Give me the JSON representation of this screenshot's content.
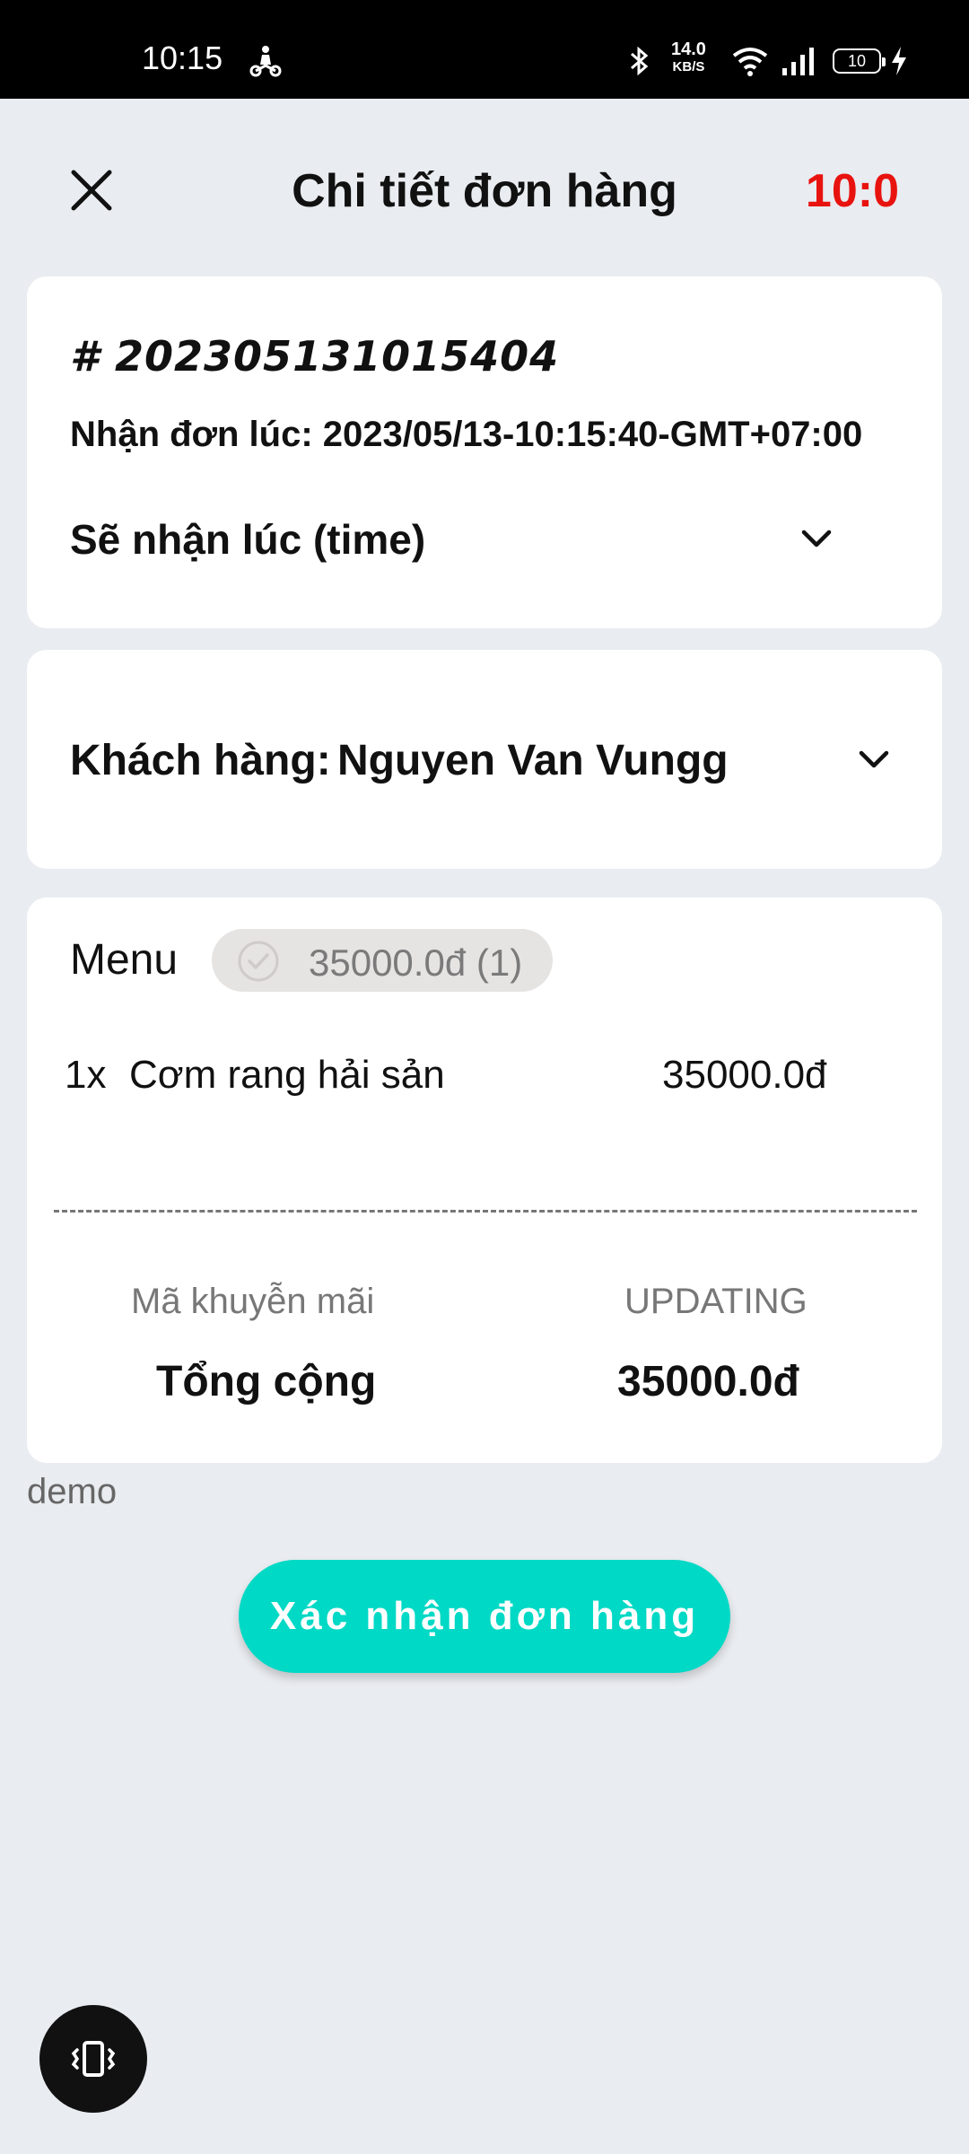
{
  "status_bar": {
    "time": "10:15",
    "speed_value": "14.0",
    "speed_unit": "KB/S",
    "battery": "10",
    "icons": [
      "rider-icon",
      "bluetooth-icon",
      "wifi-icon",
      "signal-icon",
      "battery-icon",
      "charging-icon"
    ]
  },
  "header": {
    "title": "Chi tiết đơn hàng",
    "timer": "10:0",
    "timer_color": "#e8130f",
    "close_icon": "close-icon"
  },
  "order": {
    "id": "# 202305131015404",
    "received_at": "Nhận đơn lúc: 2023/05/13-10:15:40-GMT+07:00",
    "will_receive": "Sẽ nhận lúc (time)"
  },
  "customer": {
    "label": "Khách hàng:",
    "name": "Nguyen Van Vungg"
  },
  "menu": {
    "label": "Menu",
    "chip": "35000.0đ (1)",
    "items": [
      {
        "qty": "1x",
        "name": "Cơm rang hải sản",
        "price": "35000.0đ"
      }
    ],
    "promo_label": "Mã khuyễn mãi",
    "promo_value": "UPDATING",
    "total_label": "Tổng cộng",
    "total_value": "35000.0đ"
  },
  "note": "demo",
  "confirm_button": "Xác nhận đơn hàng",
  "accent_color": "#00d9c5"
}
